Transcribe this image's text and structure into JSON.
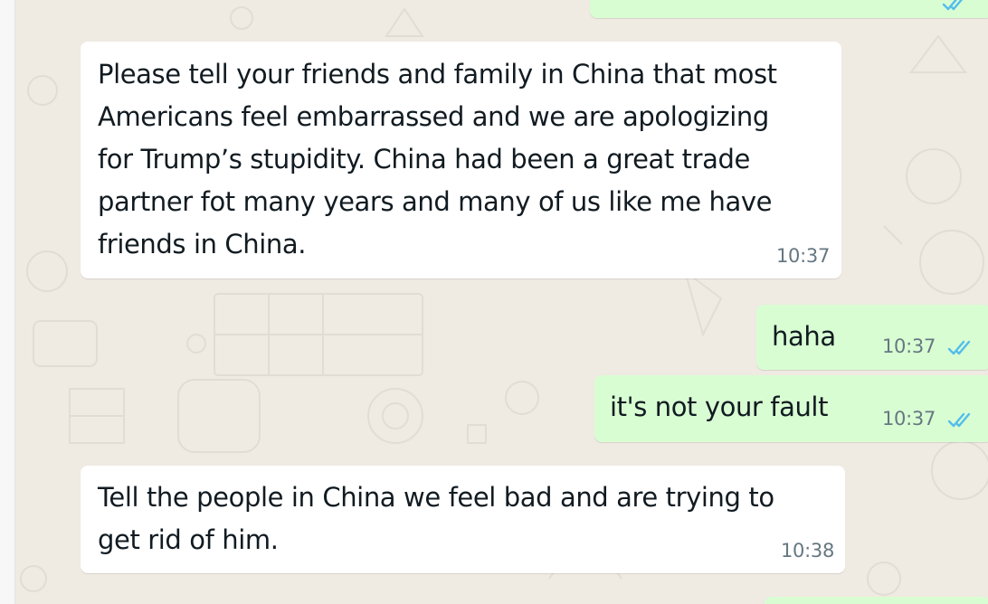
{
  "colors": {
    "wallpaper": "#efeae2",
    "incoming_bubble": "#ffffff",
    "outgoing_bubble": "#d9fdd3",
    "read_receipt": "#53bdeb",
    "text": "#111b21",
    "timestamp": "#667781"
  },
  "top_partial_message": {
    "direction": "outgoing",
    "status_icon": "double-check-read-icon"
  },
  "messages": [
    {
      "direction": "incoming",
      "lines": [
        "Please tell your friends and family in China that most",
        "Americans feel embarrassed and we are apologizing",
        "for Trump’s stupidity. China had been a great trade",
        "partner fot many years and many of us like me have",
        "friends in China."
      ],
      "time": "10:37"
    },
    {
      "direction": "outgoing",
      "lines": [
        "haha"
      ],
      "time": "10:37",
      "status_icon": "double-check-read-icon"
    },
    {
      "direction": "outgoing",
      "lines": [
        "it's not your fault"
      ],
      "time": "10:37",
      "status_icon": "double-check-read-icon"
    },
    {
      "direction": "incoming",
      "lines": [
        "Tell the people in China we feel bad and are trying to",
        "get rid of him."
      ],
      "time": "10:38"
    }
  ],
  "bottom_partial_message": {
    "direction": "outgoing"
  }
}
